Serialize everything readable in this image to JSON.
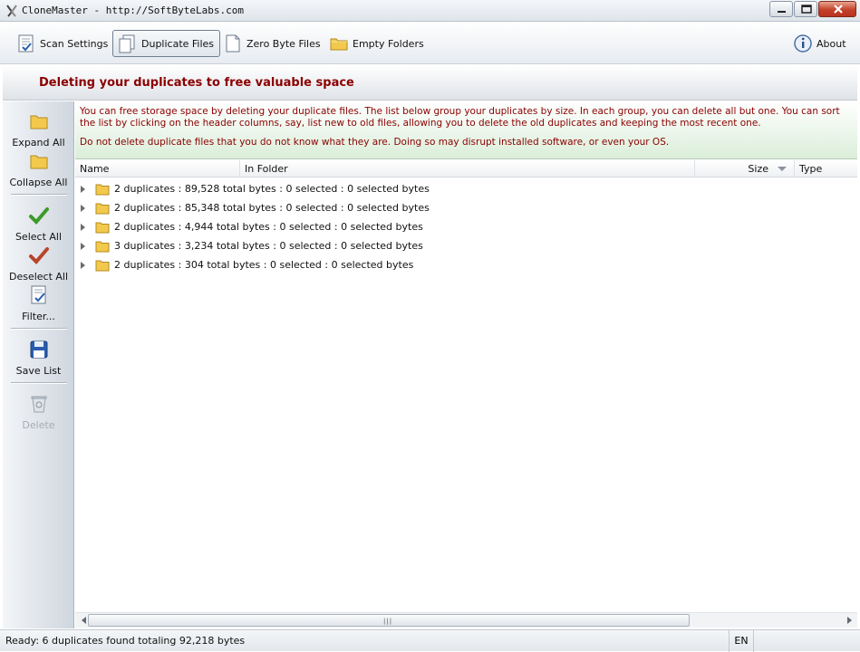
{
  "window": {
    "title": "CloneMaster - http://SoftByteLabs.com"
  },
  "toolbar": {
    "scan_settings": "Scan Settings",
    "duplicate_files": "Duplicate Files",
    "zero_byte_files": "Zero Byte Files",
    "empty_folders": "Empty Folders",
    "about": "About"
  },
  "banner": {
    "title": "Deleting your duplicates to free valuable space"
  },
  "sidebar": {
    "expand_all": "Expand All",
    "collapse_all": "Collapse All",
    "select_all": "Select All",
    "deselect_all": "Deselect All",
    "filter": "Filter...",
    "save_list": "Save List",
    "delete": "Delete"
  },
  "info": {
    "line1": "You can free storage space by deleting your duplicate files. The list below group your duplicates by size. In each group, you can delete all but one. You can sort the list by clicking on the header columns, say, list new to old files, allowing you to delete the old duplicates and keeping the most recent one.",
    "warning": "Do not delete duplicate files that you do not know what they are. Doing so may disrupt installed software, or even your OS."
  },
  "columns": {
    "name": "Name",
    "in_folder": "In Folder",
    "size": "Size",
    "type": "Type"
  },
  "groups": [
    "2 duplicates  :  89,528 total bytes  :  0 selected  :  0 selected bytes",
    "2 duplicates  :  85,348 total bytes  :  0 selected  :  0 selected bytes",
    "2 duplicates  :  4,944 total bytes  :  0 selected  :  0 selected bytes",
    "3 duplicates  :  3,234 total bytes  :  0 selected  :  0 selected bytes",
    "2 duplicates  :  304 total bytes  :  0 selected  :  0 selected bytes"
  ],
  "status": {
    "text": "Ready:  6 duplicates found totaling 92,218 bytes",
    "language": "EN"
  },
  "colors": {
    "accent_red": "#8b0000",
    "folder_yellow": "#f2c94c",
    "check_green": "#3c9a2a",
    "check_red": "#b8452a",
    "save_blue": "#2a5db0"
  },
  "icons": {
    "scan_settings": "checklist-document-icon",
    "duplicate_files": "duplicate-documents-icon",
    "zero_byte_files": "blank-document-icon",
    "empty_folders": "folder-icon",
    "about": "info-icon",
    "expand_all": "folder-icon",
    "collapse_all": "folder-icon",
    "select_all": "green-checkmark-icon",
    "deselect_all": "red-checkmark-icon",
    "filter": "filter-document-icon",
    "save_list": "floppy-disk-icon",
    "delete": "recycle-bin-icon"
  }
}
